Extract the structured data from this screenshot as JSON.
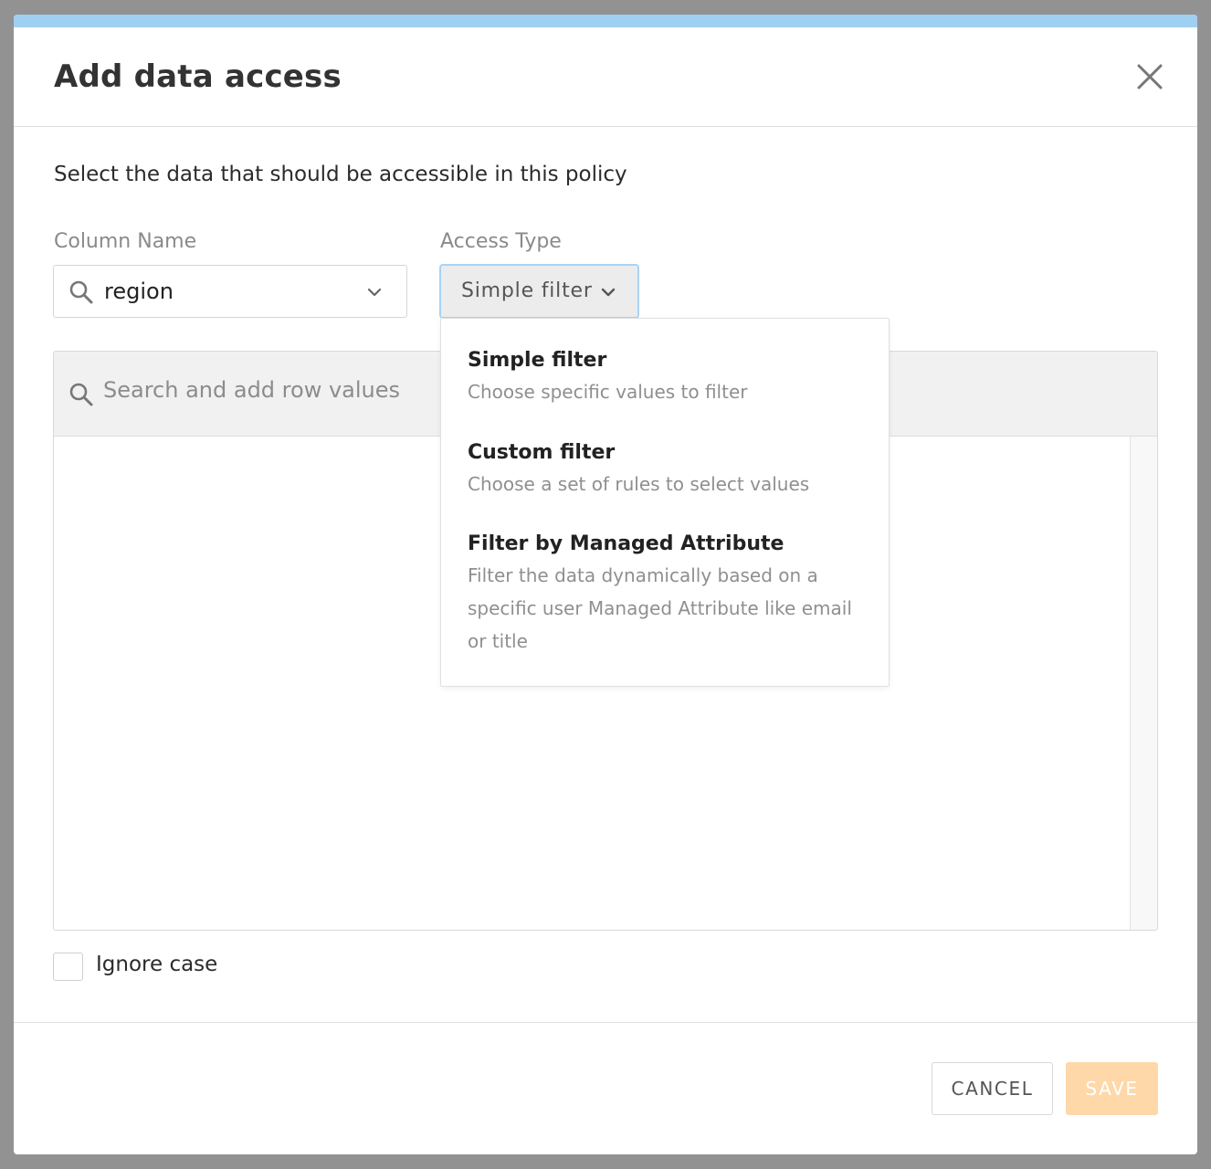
{
  "dialog": {
    "title": "Add data access",
    "subtitle": "Select the data that should be accessible in this policy"
  },
  "column_name": {
    "label": "Column Name",
    "value": "region"
  },
  "access_type": {
    "label": "Access Type",
    "value": "Simple filter",
    "options": [
      {
        "title": "Simple filter",
        "description": "Choose specific values to filter"
      },
      {
        "title": "Custom filter",
        "description": "Choose a set of rules to select values"
      },
      {
        "title": "Filter by Managed Attribute",
        "description": "Filter the data dynamically based on a specific user Managed Attribute like email or title"
      }
    ]
  },
  "row_values": {
    "placeholder": "Search and add row values"
  },
  "ignore_case": {
    "label": "Ignore case",
    "checked": false
  },
  "footer": {
    "cancel_label": "CANCEL",
    "save_label": "SAVE"
  },
  "colors": {
    "accent_top": "#9fcff1",
    "save_disabled": "#fed8a9",
    "overlay": "#929292"
  }
}
